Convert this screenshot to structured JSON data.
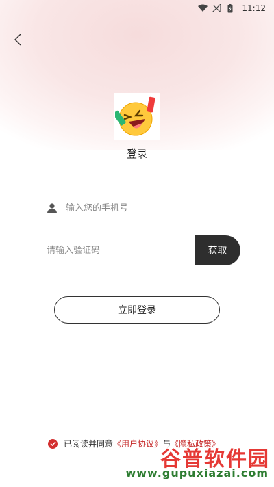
{
  "status_bar": {
    "time": "11:12",
    "icons": [
      "wifi-icon",
      "no-signal-icon",
      "battery-icon"
    ]
  },
  "nav": {
    "back_icon": "chevron-left-icon"
  },
  "logo": {
    "icon": "laughing-emoji-icon"
  },
  "title": "登录",
  "phone": {
    "icon": "user-icon",
    "placeholder": "输入您的手机号",
    "value": ""
  },
  "code": {
    "placeholder": "请输入验证码",
    "value": "",
    "get_label": "获取"
  },
  "login_label": "立即登录",
  "agreement": {
    "checked": true,
    "prefix": "已阅读并同意",
    "user_agreement": "《用户协议》",
    "conjunction": "与",
    "privacy_policy": "《隐私政策》"
  },
  "watermark": {
    "main": "谷普软件园",
    "sub": "www.gupuxiazai.com"
  },
  "colors": {
    "accent": "#d32f2f",
    "button_dark": "#2e2e2e",
    "link": "#c62828"
  }
}
